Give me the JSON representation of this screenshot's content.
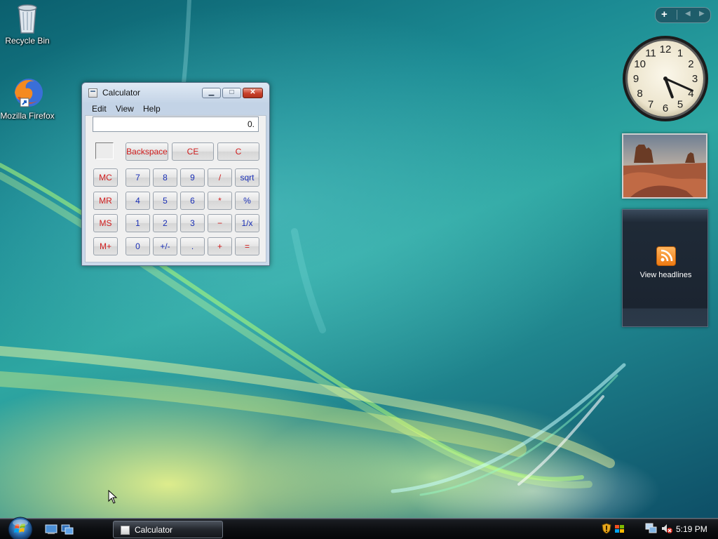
{
  "desktop": {
    "icons": [
      {
        "label": "Recycle Bin",
        "icon": "recycle-bin-icon"
      },
      {
        "label": "Mozilla Firefox",
        "icon": "firefox-icon"
      }
    ]
  },
  "calculator": {
    "title": "Calculator",
    "caption_buttons": {
      "minimize": "▁",
      "maximize": "□",
      "close": "✕"
    },
    "menu": [
      "Edit",
      "View",
      "Help"
    ],
    "display": "0.",
    "top_row": [
      "Backspace",
      "CE",
      "C"
    ],
    "memory_buttons": [
      "MC",
      "MR",
      "MS",
      "M+"
    ],
    "keypad": [
      [
        "7",
        "8",
        "9",
        "/",
        "sqrt"
      ],
      [
        "4",
        "5",
        "6",
        "*",
        "%"
      ],
      [
        "1",
        "2",
        "3",
        "−",
        "1/x"
      ],
      [
        "0",
        "+/-",
        ".",
        "+",
        "="
      ]
    ],
    "colors": {
      "operator": "#d01c1c",
      "digit": "#1a2fb5"
    }
  },
  "sidebar": {
    "controls": {
      "add": "+",
      "prev": "◀",
      "next": "▶"
    },
    "clock": {
      "numerals": [
        "12",
        "1",
        "2",
        "3",
        "4",
        "5",
        "6",
        "7",
        "8",
        "9",
        "10",
        "11"
      ],
      "hour": 5,
      "minute": 19
    },
    "feed": {
      "label": "View headlines",
      "icon": "rss-icon"
    }
  },
  "taskbar": {
    "start_icon": "windows-start-orb",
    "quick_launch": [
      "show-desktop-icon",
      "switch-windows-icon"
    ],
    "tasks": [
      {
        "label": "Calculator",
        "icon": "calculator-icon"
      }
    ],
    "tray_icons": [
      "security-shield-icon",
      "windows-update-icon",
      "network-icon",
      "volume-muted-icon"
    ],
    "clock": "5:19 PM"
  }
}
